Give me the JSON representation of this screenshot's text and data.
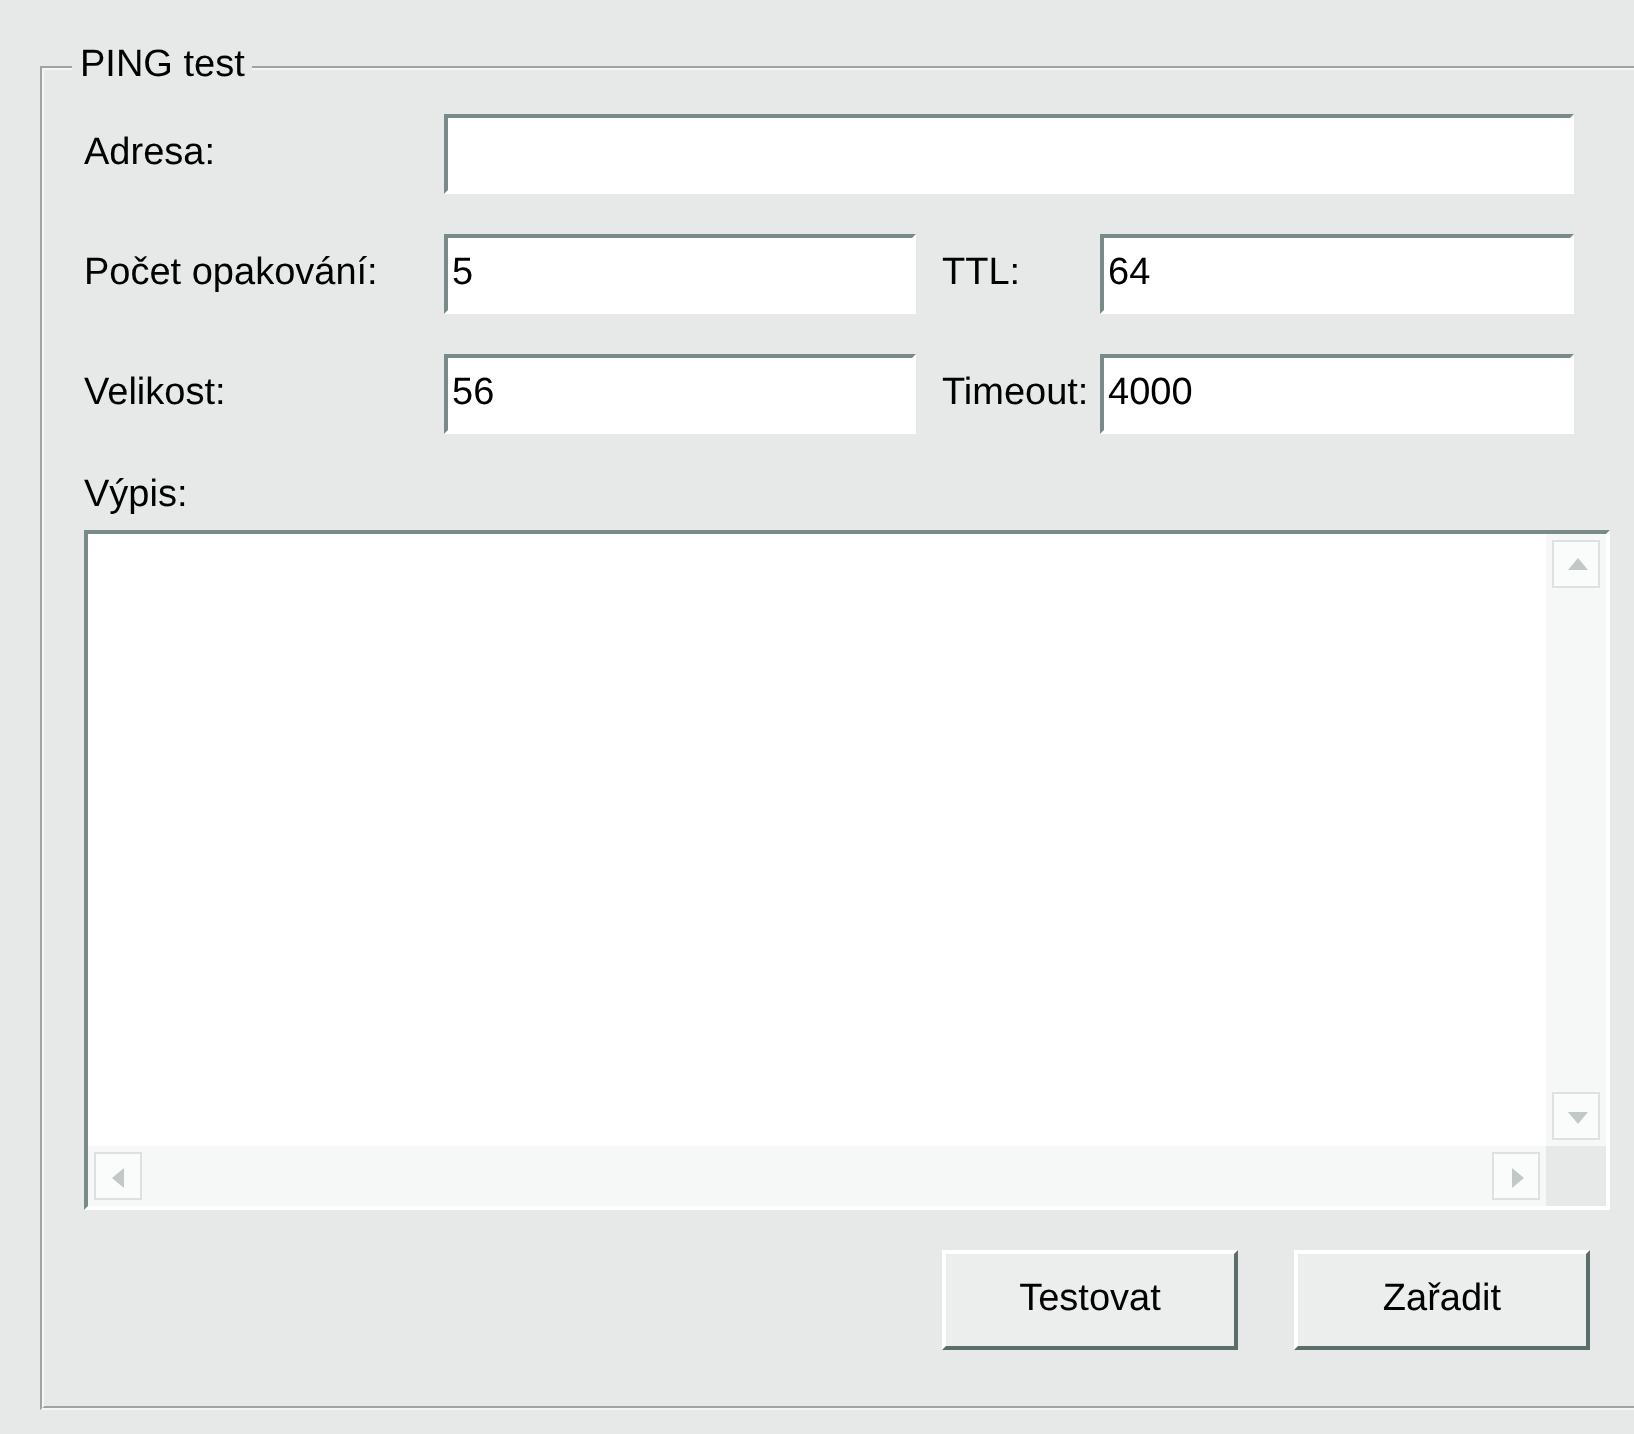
{
  "group": {
    "title": "PING test"
  },
  "address": {
    "label": "Adresa:"
  },
  "fields": [
    {
      "label": "Počet opakování:",
      "value": "5"
    },
    {
      "label": "TTL:",
      "value": "64"
    },
    {
      "label": "Velikost:",
      "value": "56"
    },
    {
      "label": "Timeout:",
      "value": "4000"
    }
  ],
  "output": {
    "label": "Výpis:"
  },
  "buttons": [
    "Testovat",
    "Zařadit"
  ]
}
